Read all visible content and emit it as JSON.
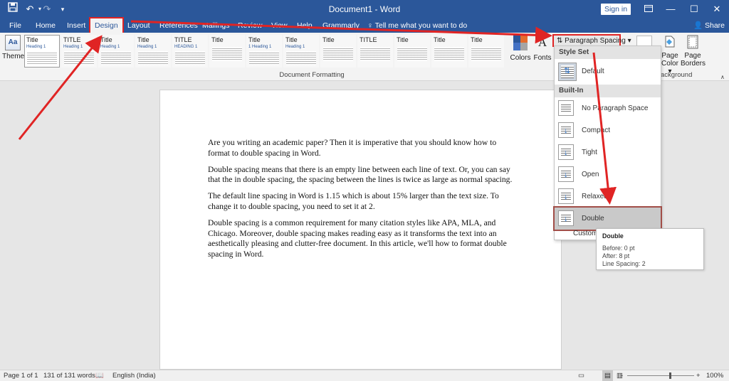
{
  "window": {
    "title": "Document1 - Word",
    "sign_in": "Sign in",
    "minimize_icon": "minimize",
    "restore_icon": "ribbon-display-options",
    "maximize_icon": "maximize",
    "close_icon": "close"
  },
  "quick_access": [
    "save-icon",
    "undo-icon",
    "redo-icon",
    "customize-icon"
  ],
  "tabs": [
    "File",
    "Home",
    "Insert",
    "Design",
    "Layout",
    "References",
    "Mailings",
    "Review",
    "View",
    "Help",
    "Grammarly"
  ],
  "active_tab": "Design",
  "tell_me": "Tell me what you want to do",
  "share": "Share",
  "ribbon": {
    "themes_label": "Themes",
    "themes_icon": "Aa",
    "style_thumbs": [
      {
        "title": "Title",
        "sub": "Heading 1"
      },
      {
        "title": "TITLE",
        "sub": "Heading 1"
      },
      {
        "title": "Title",
        "sub": "Heading 1"
      },
      {
        "title": "Title",
        "sub": "Heading 1"
      },
      {
        "title": "TITLE",
        "sub": "HEADING 1"
      },
      {
        "title": "Title",
        "sub": ""
      },
      {
        "title": "Title",
        "sub": "1 Heading 1"
      },
      {
        "title": "Title",
        "sub": "Heading 1"
      },
      {
        "title": "Title",
        "sub": ""
      },
      {
        "title": "TITLE",
        "sub": ""
      },
      {
        "title": "Title",
        "sub": ""
      },
      {
        "title": "Title",
        "sub": ""
      },
      {
        "title": "Title",
        "sub": ""
      }
    ],
    "group_document_formatting": "Document Formatting",
    "colors_label": "Colors",
    "fonts_label": "Fonts",
    "paragraph_spacing": "Paragraph Spacing",
    "page_color_line1": "Page",
    "page_color_line2": "Color",
    "page_borders_line1": "Page",
    "page_borders_line2": "Borders",
    "group_page_background": "ackground",
    "accent_color": "#2b579a",
    "annotation_color": "#e02424"
  },
  "dropdown": {
    "header_style_set": "Style Set",
    "default_label": "Default",
    "header_built_in": "Built-In",
    "items": [
      "No Paragraph Space",
      "Compact",
      "Tight",
      "Open",
      "Relaxed",
      "Double"
    ],
    "highlighted": "Double",
    "custom_label": "Custom P"
  },
  "tooltip": {
    "title": "Double",
    "before": "Before: 0 pt",
    "after": "After: 8 pt",
    "line_spacing": "Line Spacing: 2"
  },
  "document": {
    "paragraphs": [
      "Are you writing an academic paper? Then it is imperative that you should know how to format to double spacing in Word.",
      "Double spacing means that there is an empty line between each line of text. Or, you can say that the in double spacing, the spacing between the lines is twice as large as normal spacing.",
      "The default line spacing in Word is 1.15 which is about 15% larger than the text size. To change it to double spacing, you need to set it at 2.",
      "Double spacing is a common requirement for many citation styles like APA, MLA, and Chicago. Moreover, double spacing makes reading easy as it transforms the text into an aesthetically pleasing and clutter-free document. In this article, we'll how to format double spacing in Word."
    ]
  },
  "status": {
    "page": "Page 1 of 1",
    "words": "131 of 131 words",
    "language": "English (India)",
    "zoom_out": "-",
    "zoom_in": "+",
    "zoom": "100%",
    "zoom_level_percent": 100
  }
}
